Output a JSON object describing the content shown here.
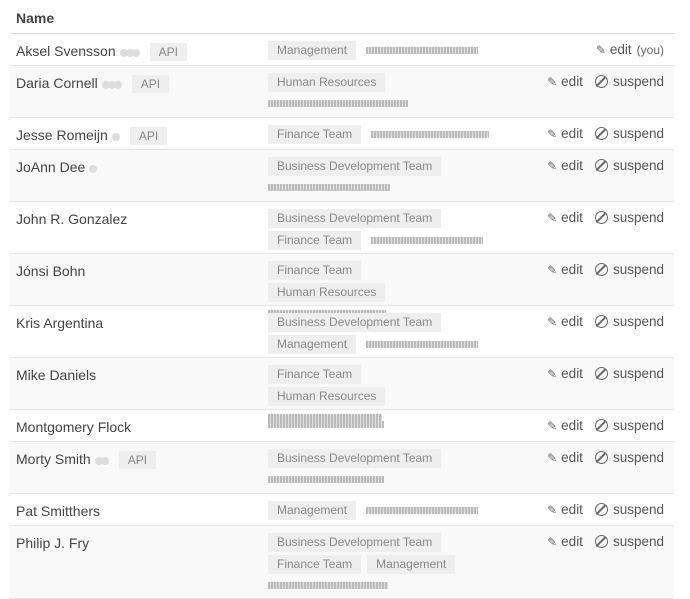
{
  "header": {
    "name_label": "Name"
  },
  "labels": {
    "edit": "edit",
    "suspend": "suspend",
    "you": "(you)",
    "api": "API"
  },
  "users": [
    {
      "name": "Aksel Svensson",
      "dots": 3,
      "api": true,
      "teams": [
        "Management"
      ],
      "email_inline": true,
      "self": true
    },
    {
      "name": "Daria Cornell",
      "dots": 3,
      "api": true,
      "teams": [
        "Human Resources"
      ],
      "email_inline": false
    },
    {
      "name": "Jesse Romeijn",
      "dots": 1,
      "api": true,
      "teams": [
        "Finance Team"
      ],
      "email_inline": true
    },
    {
      "name": "JoAnn Dee",
      "dots": 1,
      "api": false,
      "teams": [
        "Business Development Team"
      ],
      "email_inline": false
    },
    {
      "name": "John R. Gonzalez",
      "dots": 0,
      "api": false,
      "teams": [
        "Business Development Team",
        "Finance Team"
      ],
      "email_inline": true
    },
    {
      "name": "Jónsi Bohn",
      "dots": 0,
      "api": false,
      "teams": [
        "Finance Team",
        "Human Resources"
      ],
      "email_inline": false
    },
    {
      "name": "Kris Argentina",
      "dots": 0,
      "api": false,
      "teams": [
        "Business Development Team",
        "Management"
      ],
      "email_inline": true
    },
    {
      "name": "Mike Daniels",
      "dots": 0,
      "api": false,
      "teams": [
        "Finance Team",
        "Human Resources"
      ],
      "email_inline": false
    },
    {
      "name": "Montgomery Flock",
      "dots": 0,
      "api": false,
      "teams": [],
      "email_inline": true
    },
    {
      "name": "Morty Smith",
      "dots": 2,
      "api": true,
      "teams": [
        "Business Development Team"
      ],
      "email_inline": false
    },
    {
      "name": "Pat Smitthers",
      "dots": 0,
      "api": false,
      "teams": [
        "Management"
      ],
      "email_inline": true
    },
    {
      "name": "Philip J. Fry",
      "dots": 0,
      "api": false,
      "teams": [
        "Business Development Team",
        "Finance Team",
        "Management"
      ],
      "email_inline": false
    }
  ]
}
